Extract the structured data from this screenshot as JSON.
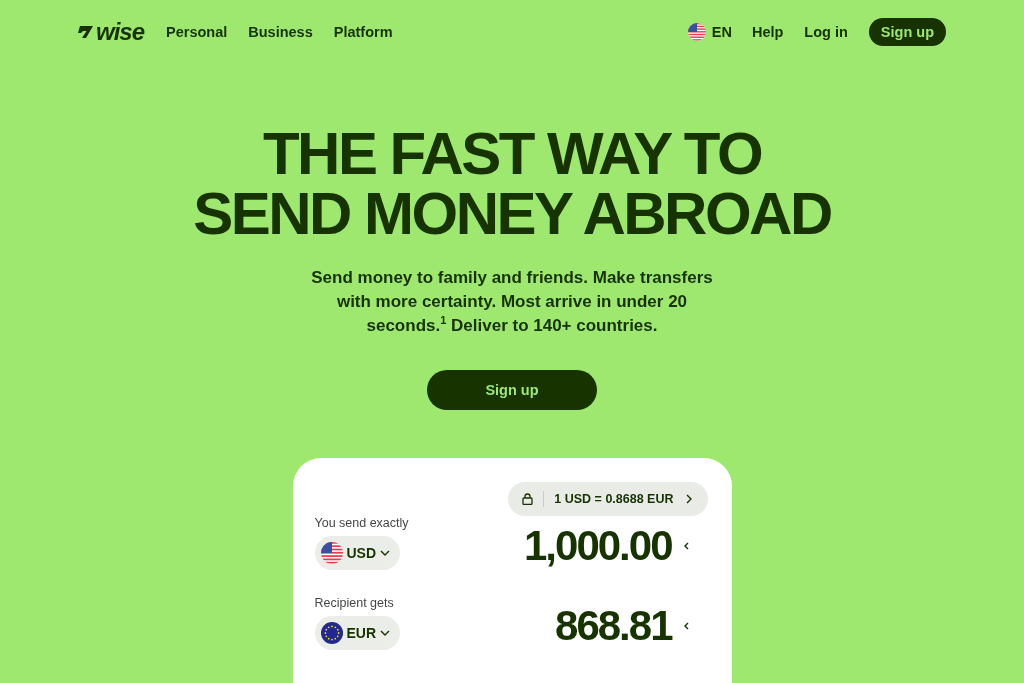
{
  "nav": {
    "logo": "wise",
    "links": [
      "Personal",
      "Business",
      "Platform"
    ],
    "language": "EN",
    "help": "Help",
    "login": "Log in",
    "signup": "Sign up"
  },
  "hero": {
    "title_lines": [
      "THE FAST WAY TO",
      "SEND MONEY ABROAD"
    ],
    "subtitle": "Send money to family and friends. Make transfers with more certainty. Most arrive in under 20 seconds.$^{1}$ Deliver to 140+ countries.",
    "button": "Sign up"
  },
  "calculator": {
    "rate": "1 USD = 0.8688 EUR",
    "rows": [
      {
        "label": "You send exactly",
        "currency": "USD",
        "kind": "us",
        "amount": "1,000.00"
      },
      {
        "label": "Recipient gets",
        "currency": "EUR",
        "kind": "eu",
        "amount": "868.81"
      }
    ]
  }
}
